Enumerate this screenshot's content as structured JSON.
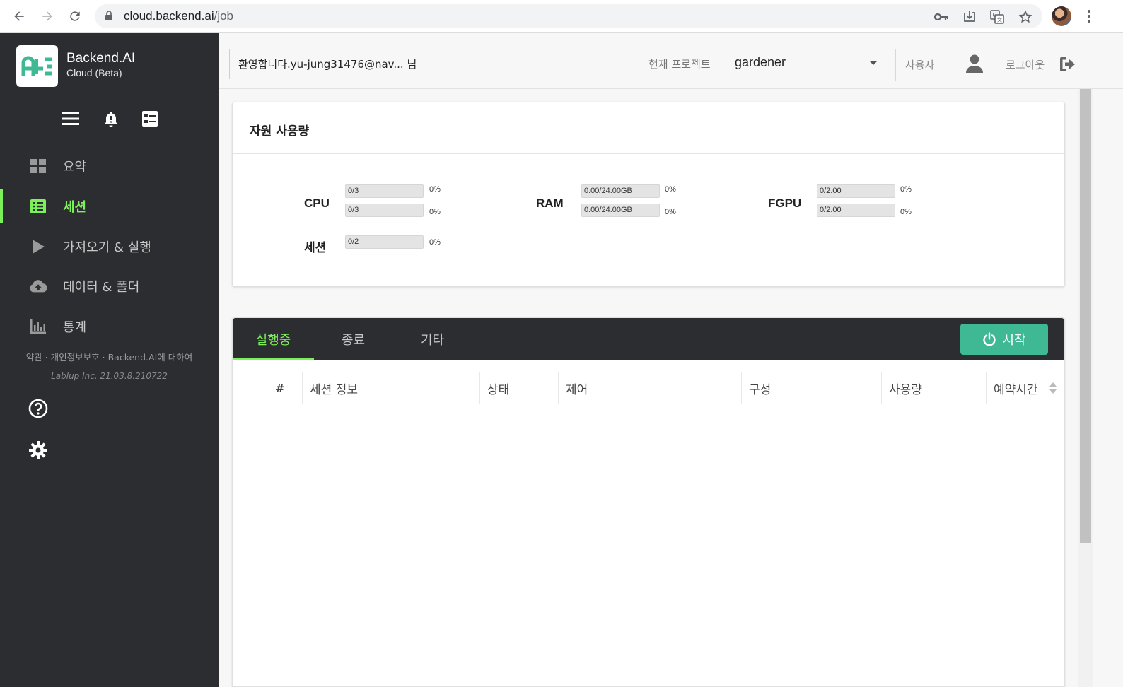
{
  "browser": {
    "url_host": "cloud.backend.ai",
    "url_path": "/job",
    "icons": [
      "back-icon",
      "forward-icon",
      "reload-icon",
      "lock-icon",
      "key-icon",
      "install-icon",
      "translate-icon",
      "star-icon",
      "profile-avatar",
      "menu-kebab-icon"
    ]
  },
  "sidebar": {
    "brand_title": "Backend.AI",
    "brand_subtitle": "Cloud (Beta)",
    "items": [
      {
        "label": "요약",
        "icon": "dashboard-icon"
      },
      {
        "label": "세션",
        "icon": "list-icon",
        "active": true
      },
      {
        "label": "가져오기 & 실행",
        "icon": "play-icon"
      },
      {
        "label": "데이터 & 폴더",
        "icon": "cloud-upload-icon"
      },
      {
        "label": "통계",
        "icon": "bar-chart-icon"
      }
    ],
    "footer_links": "약관 · 개인정보보호 · Backend.AI에 대하여",
    "version": "Lablup Inc. 21.03.8.210722"
  },
  "header": {
    "welcome": "환영합니다.yu-jung31476@nav... 님",
    "project_label": "현재 프로젝트",
    "project_value": "gardener",
    "user_label": "사용자",
    "logout_label": "로그아웃"
  },
  "resources": {
    "title": "자원 사용량",
    "cpu": {
      "name": "CPU",
      "bar1": "0/3",
      "pct1": "0%",
      "fill1": 0,
      "bar2": "0/3",
      "pct2": "0%",
      "fill2": 0
    },
    "ram": {
      "name": "RAM",
      "bar1": "0.00/24.00GB",
      "pct1": "0%",
      "fill1": 0,
      "bar2": "0.00/24.00GB",
      "pct2": "0%",
      "fill2": 0
    },
    "fgpu": {
      "name": "FGPU",
      "bar1": "0/2.00",
      "pct1": "0%",
      "fill1": 0,
      "bar2": "0/2.00",
      "pct2": "0%",
      "fill2": 0
    },
    "session": {
      "name": "세션",
      "bar1": "0/2",
      "pct1": "0%",
      "fill1": 0
    }
  },
  "sessions": {
    "tabs": [
      "실행중",
      "종료",
      "기타"
    ],
    "active_tab": 0,
    "start_label": "시작",
    "columns": [
      "#",
      "세션 정보",
      "상태",
      "제어",
      "구성",
      "사용량",
      "예약시간"
    ],
    "rows": []
  },
  "colors": {
    "accent": "#7cf058",
    "sidebar_bg": "#2b2d30",
    "start_button": "#3fb894"
  }
}
